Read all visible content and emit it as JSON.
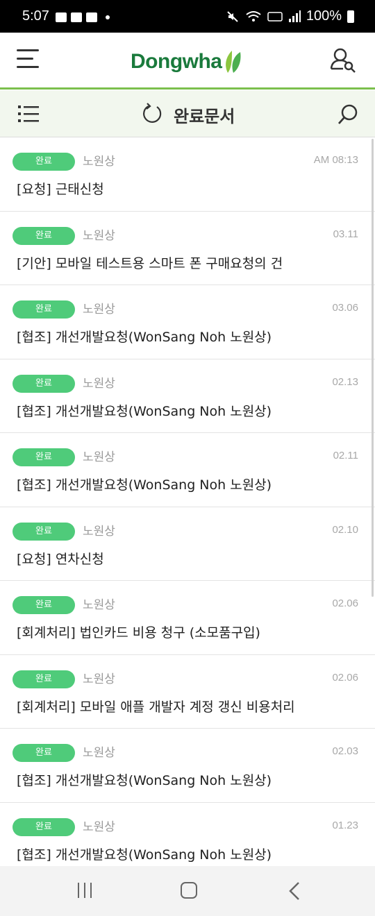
{
  "status_bar": {
    "time": "5:07",
    "battery": "100%"
  },
  "header": {
    "logo_text": "Dongwha",
    "brand_color": "#1a7a3c",
    "accent_color": "#7bbf4c"
  },
  "toolbar": {
    "title": "완료문서"
  },
  "documents": [
    {
      "status": "완료",
      "author": "노원상",
      "date": "AM 08:13",
      "title": "[요청] 근태신청"
    },
    {
      "status": "완료",
      "author": "노원상",
      "date": "03.11",
      "title": "[기안] 모바일 테스트용 스마트 폰 구매요청의 건"
    },
    {
      "status": "완료",
      "author": "노원상",
      "date": "03.06",
      "title": "[협조] 개선개발요청(WonSang Noh 노원상)"
    },
    {
      "status": "완료",
      "author": "노원상",
      "date": "02.13",
      "title": "[협조] 개선개발요청(WonSang Noh 노원상)"
    },
    {
      "status": "완료",
      "author": "노원상",
      "date": "02.11",
      "title": "[협조] 개선개발요청(WonSang Noh 노원상)"
    },
    {
      "status": "완료",
      "author": "노원상",
      "date": "02.10",
      "title": "[요청] 연차신청"
    },
    {
      "status": "완료",
      "author": "노원상",
      "date": "02.06",
      "title": "[회계처리] 법인카드 비용 청구 (소모품구입)"
    },
    {
      "status": "완료",
      "author": "노원상",
      "date": "02.06",
      "title": "[회계처리] 모바일 애플 개발자 계정 갱신 비용처리"
    },
    {
      "status": "완료",
      "author": "노원상",
      "date": "02.03",
      "title": "[협조] 개선개발요청(WonSang Noh 노원상)"
    },
    {
      "status": "완료",
      "author": "노원상",
      "date": "01.23",
      "title": "[협조] 개선개발요청(WonSang Noh 노원상)"
    }
  ],
  "badge_color": "#4fcb7a"
}
